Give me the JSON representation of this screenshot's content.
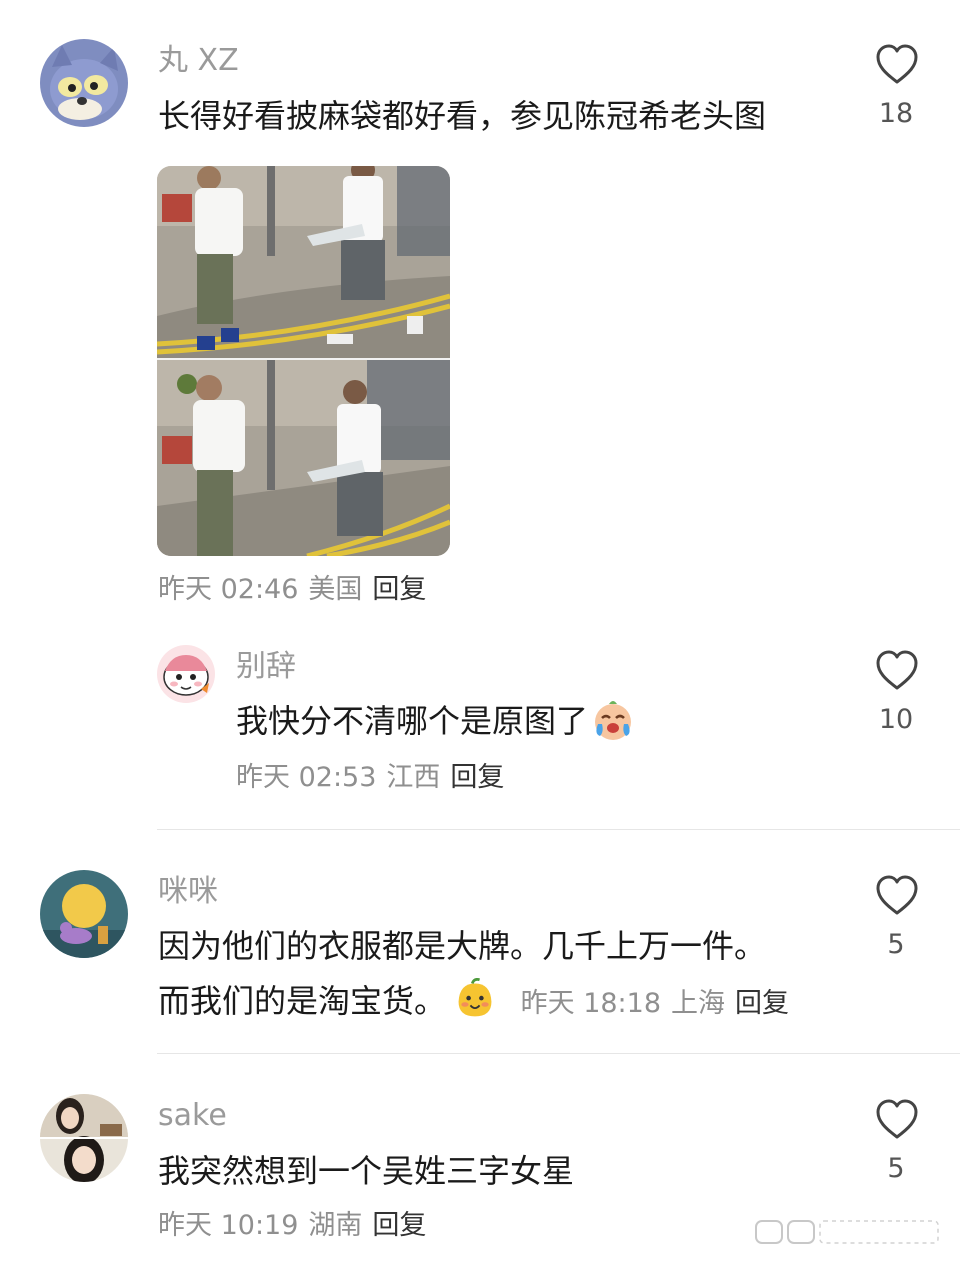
{
  "comments": [
    {
      "username": "丸 XZ",
      "text": "长得好看披麻袋都好看，参见陈冠希老头图",
      "time": "昨天 02:46",
      "location": "美国",
      "reply_label": "回复",
      "likes": "18"
    },
    {
      "username": "别辞",
      "text": "我快分不清哪个是原图了",
      "time": "昨天 02:53",
      "location": "江西",
      "reply_label": "回复",
      "likes": "10"
    },
    {
      "username": "咪咪",
      "text_line1": "因为他们的衣服都是大牌。几千上万一件。",
      "text_line2": "而我们的是淘宝货。",
      "time": "昨天 18:18",
      "location": "上海",
      "reply_label": "回复",
      "likes": "5"
    },
    {
      "username": "sake",
      "text": "我突然想到一个吴姓三字女星",
      "time": "昨天 10:19",
      "location": "湖南",
      "reply_label": "回复",
      "likes": "5"
    }
  ],
  "icons": {
    "like": "heart-outline-icon",
    "emoji_cry": "crying-face-emoji",
    "emoji_mango": "smiling-fruit-emoji"
  },
  "colors": {
    "username": "#9a9a9a",
    "meta": "#8f8f8f",
    "text": "#1a1a1a"
  }
}
